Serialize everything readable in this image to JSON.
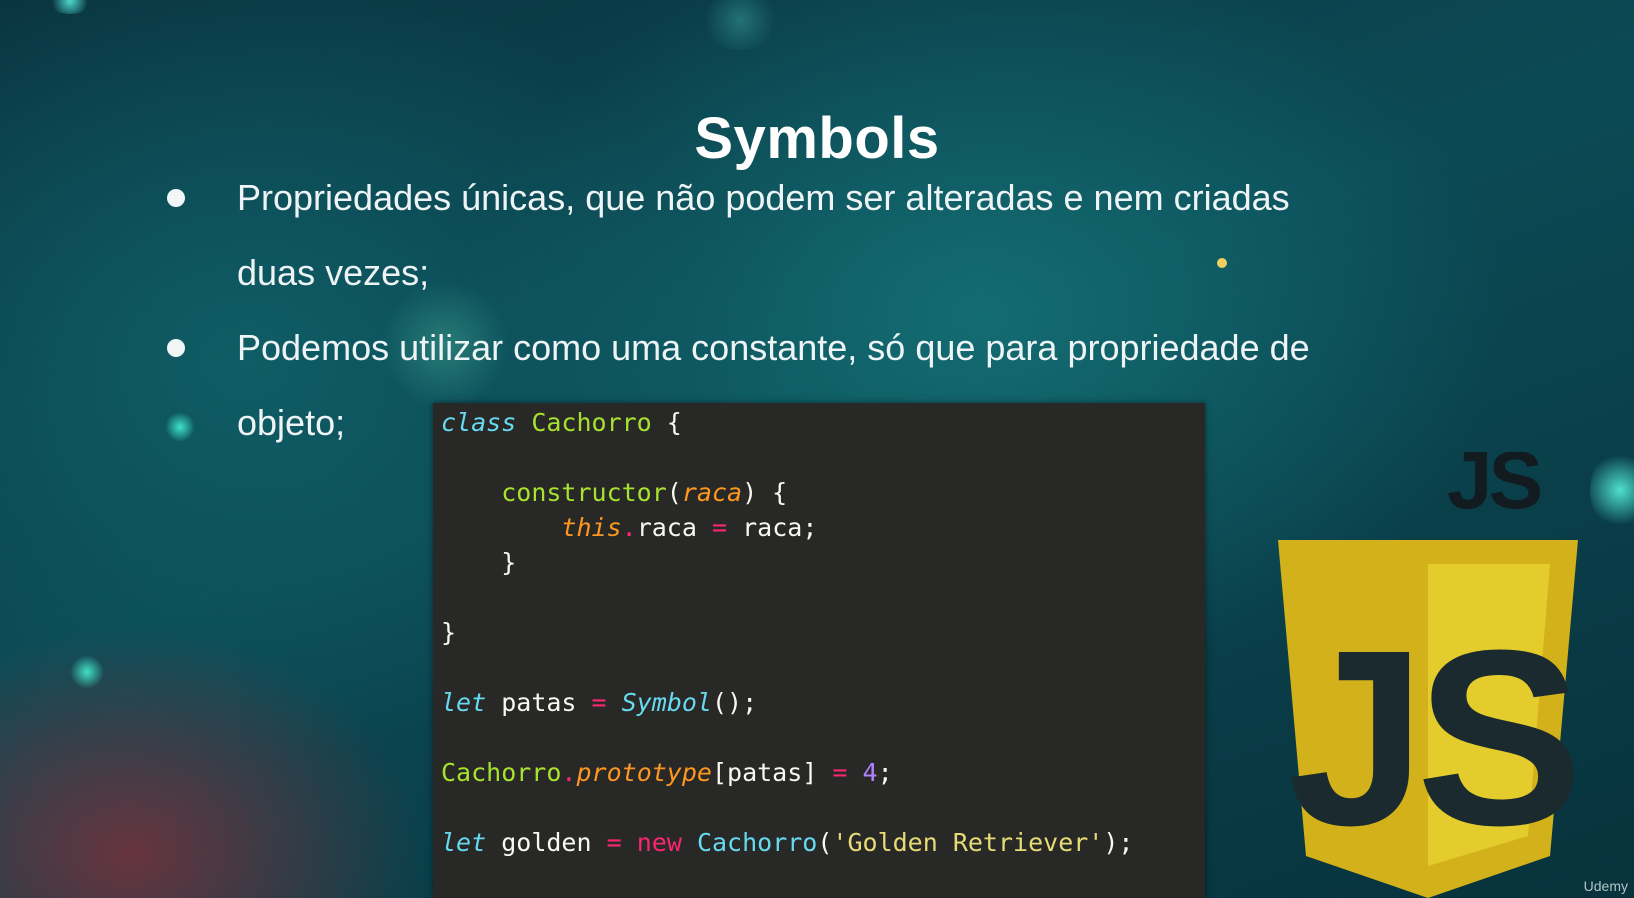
{
  "slide": {
    "title": "Symbols",
    "bullets": [
      "Propriedades únicas, que não podem ser alteradas e nem criadas duas vezes;",
      "Podemos utilizar como uma constante, só que para propriedade de objeto;"
    ]
  },
  "code": {
    "lines": [
      "class Cachorro {",
      "",
      "    constructor(raca) {",
      "        this.raca = raca;",
      "    }",
      "",
      "}",
      "",
      "let patas = Symbol();",
      "",
      "Cachorro.prototype[patas] = 4;",
      "",
      "let golden = new Cachorro('Golden Retriever');"
    ],
    "tokens": {
      "class_kw": "class",
      "class_name": "Cachorro",
      "brace_open": " {",
      "ctor": "constructor",
      "param": "raca",
      "this_kw": "this",
      "prop": "raca",
      "assign": "=",
      "semicolon": ";",
      "let_kw": "let",
      "patas": "patas",
      "symbol_fn": "Symbol",
      "prototype": "prototype",
      "number": "4",
      "golden": "golden",
      "new_kw": "new",
      "string_arg": "'Golden Retriever'"
    }
  },
  "logo": {
    "small_text": "JS",
    "shield_text": "JS",
    "colors": {
      "shield": "#d9b91b",
      "shield_light": "#ead235",
      "letters": "#1a2a2f"
    }
  },
  "watermark": "Udemy",
  "theme": {
    "background": "#0b4a55",
    "code_bg": "#282827"
  }
}
